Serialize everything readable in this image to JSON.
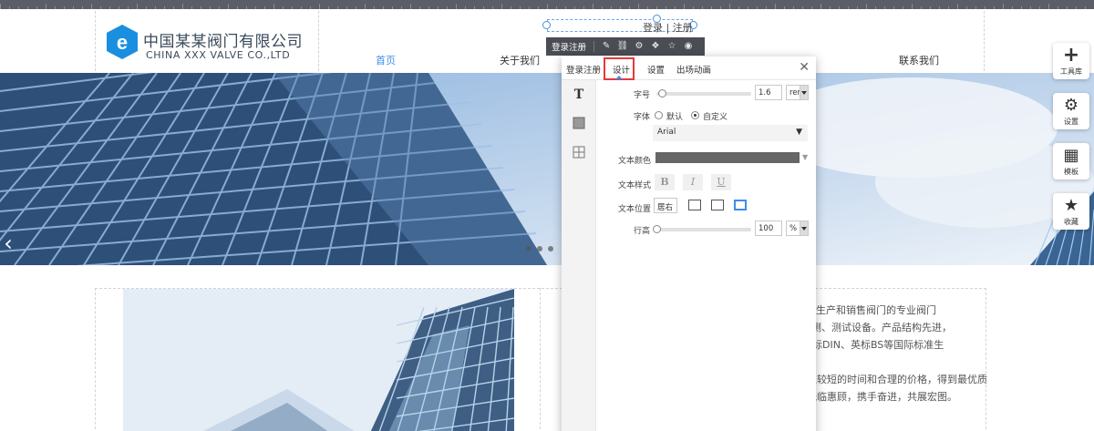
{
  "header": {
    "company_cn": "中国某某阀门有限公司",
    "company_en": "CHINA XXX VALVE CO.,LTD",
    "login_text": "登录 | 注册",
    "nav": [
      {
        "label": "首页",
        "active": true
      },
      {
        "label": "关于我们",
        "active": false
      },
      {
        "label": "联系我们",
        "active": false
      }
    ]
  },
  "mini_toolbar": {
    "label": "登录注册",
    "icons": [
      "edit-icon",
      "link-icon",
      "settings-icon",
      "layers-icon",
      "star-icon",
      "eye-icon"
    ]
  },
  "panel": {
    "tabs": [
      "登录注册",
      "设计",
      "设置",
      "出场动画"
    ],
    "selected_tab": "设计",
    "font_size": {
      "label": "字号",
      "value": "1.6",
      "unit": "rem"
    },
    "font_family": {
      "label": "字体",
      "default_label": "默认",
      "custom_label": "自定义",
      "selected": "custom",
      "font": "Arial"
    },
    "text_color": {
      "label": "文本颜色",
      "value": "#666666"
    },
    "text_style": {
      "label": "文本样式",
      "bold": "B",
      "italic": "I",
      "underline": "U"
    },
    "text_position": {
      "label": "文本位置",
      "value": "居右"
    },
    "line_height": {
      "label": "行高",
      "value": "100",
      "unit": "%"
    }
  },
  "rail": [
    {
      "label": "工具库",
      "icon": "plus-icon"
    },
    {
      "label": "设置",
      "icon": "gears-icon"
    },
    {
      "label": "模板",
      "icon": "template-icon"
    },
    {
      "label": "收藏",
      "icon": "favorite-icon"
    }
  ],
  "content": {
    "lines": [
      "、开发生产和销售阀门的专业阀门",
      "和检测、测试设备。产品结构先进，",
      "等标DIN、英标BS等国际标准生",
      "提高管理水平，进一步开拓国际国内阀门市场，使客户以较短的时间和合理的价格，得到最优质",
      "的产品和最满意的服务。我们竭诚欢迎国内外新老朋友光临惠顾，携手奋进，共展宏图。"
    ]
  },
  "colors": {
    "accent": "#3d8ee8",
    "highlight": "#e33a3a",
    "logo": "#1a8fe0"
  }
}
